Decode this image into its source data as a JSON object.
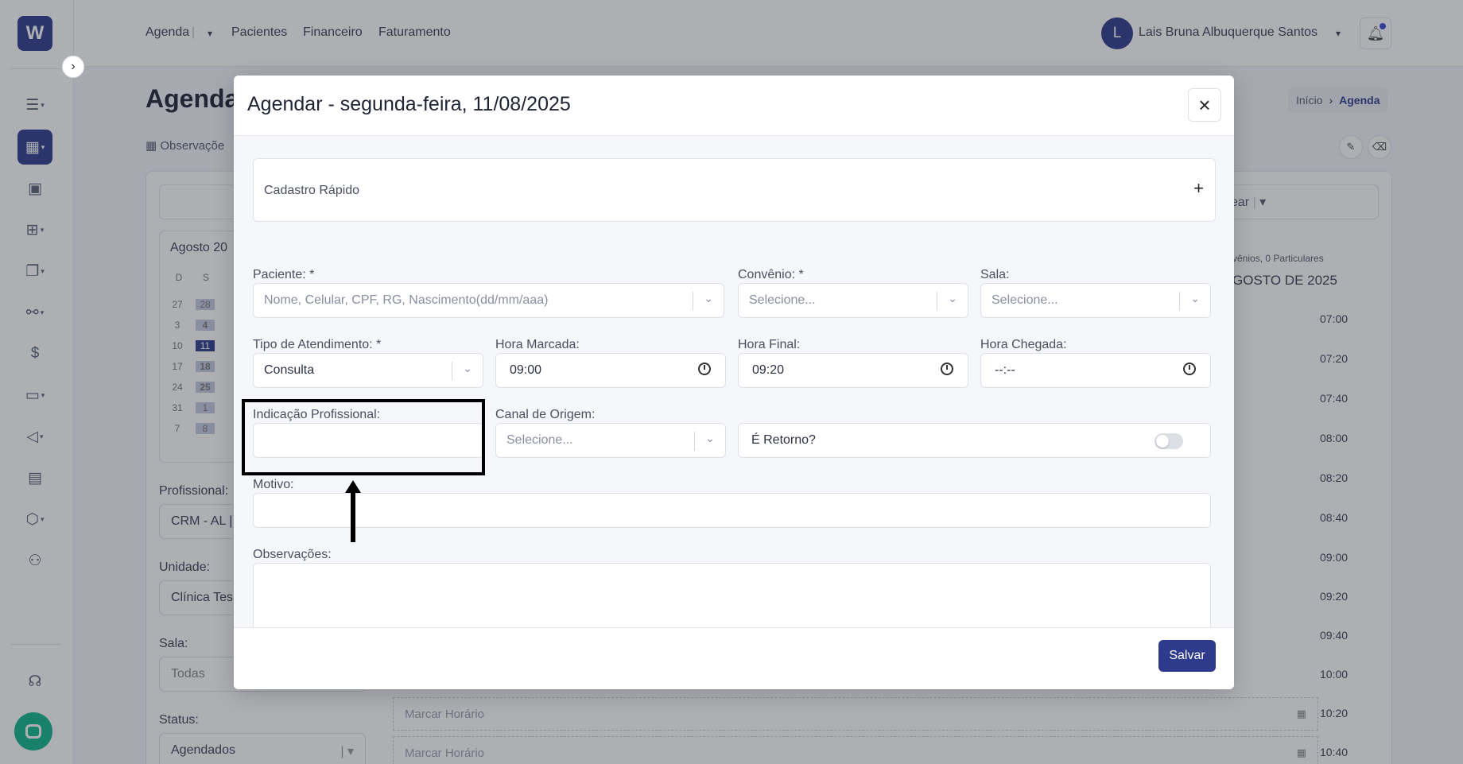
{
  "app": {
    "logo": "W",
    "nav": [
      "Agenda",
      "Pacientes",
      "Financeiro",
      "Faturamento"
    ],
    "user": {
      "initial": "L",
      "name": "Lais Bruna Albuquerque Santos"
    },
    "page_title": "Agenda",
    "breadcrumb": {
      "home": "Início",
      "current": "Agenda"
    },
    "observacoes_link": "Observaçõe",
    "filter_label": "ear",
    "calendar": {
      "month": "Agosto  20",
      "weekdays": [
        "D",
        "S"
      ],
      "rows": [
        [
          "27",
          "28"
        ],
        [
          "3",
          "4"
        ],
        [
          "10",
          "11"
        ],
        [
          "17",
          "18"
        ],
        [
          "24",
          "25"
        ],
        [
          "31",
          "1"
        ],
        [
          "7",
          "8"
        ]
      ]
    },
    "sidebar_fields": [
      {
        "label": "Profissional:",
        "value": "CRM - AL |"
      },
      {
        "label": "Unidade:",
        "value": "Clínica Tes"
      },
      {
        "label": "Sala:",
        "value": "Todas"
      },
      {
        "label": "Status:",
        "value": "Agendados"
      }
    ],
    "schedule": {
      "subtitle": "vênios, 0 Particulares",
      "title": "GOSTO DE 2025",
      "times": [
        "07:00",
        "07:20",
        "07:40",
        "08:00",
        "08:20",
        "08:40",
        "09:00",
        "09:20",
        "09:40",
        "10:00",
        "10:20",
        "10:40"
      ],
      "slot_label": "Marcar Horário"
    }
  },
  "modal": {
    "title": "Agendar - segunda-feira, 11/08/2025",
    "close_icon": "×",
    "quick_register": {
      "label": "Cadastro Rápido",
      "icon": "+"
    },
    "fields": {
      "paciente": {
        "label": "Paciente: *",
        "placeholder": "Nome, Celular, CPF, RG, Nascimento(dd/mm/aaa)"
      },
      "convenio": {
        "label": "Convênio: *",
        "placeholder": "Selecione..."
      },
      "sala": {
        "label": "Sala:",
        "placeholder": "Selecione..."
      },
      "tipo_atendimento": {
        "label": "Tipo de Atendimento: *",
        "value": "Consulta"
      },
      "hora_marcada": {
        "label": "Hora Marcada:",
        "value": "09:00"
      },
      "hora_final": {
        "label": "Hora Final:",
        "value": "09:20"
      },
      "hora_chegada": {
        "label": "Hora Chegada:",
        "value": "--:--"
      },
      "indicacao": {
        "label": "Indicação Profissional:",
        "value": ""
      },
      "canal_origem": {
        "label": "Canal de Origem:",
        "placeholder": "Selecione..."
      },
      "retorno": {
        "label": "É Retorno?",
        "checked": false
      },
      "motivo": {
        "label": "Motivo:",
        "value": ""
      },
      "observacoes": {
        "label": "Observações:",
        "value": ""
      }
    },
    "save_label": "Salvar"
  },
  "colors": {
    "primary": "#2e3a8c",
    "chat": "#10b58a",
    "highlight": "#000000"
  }
}
